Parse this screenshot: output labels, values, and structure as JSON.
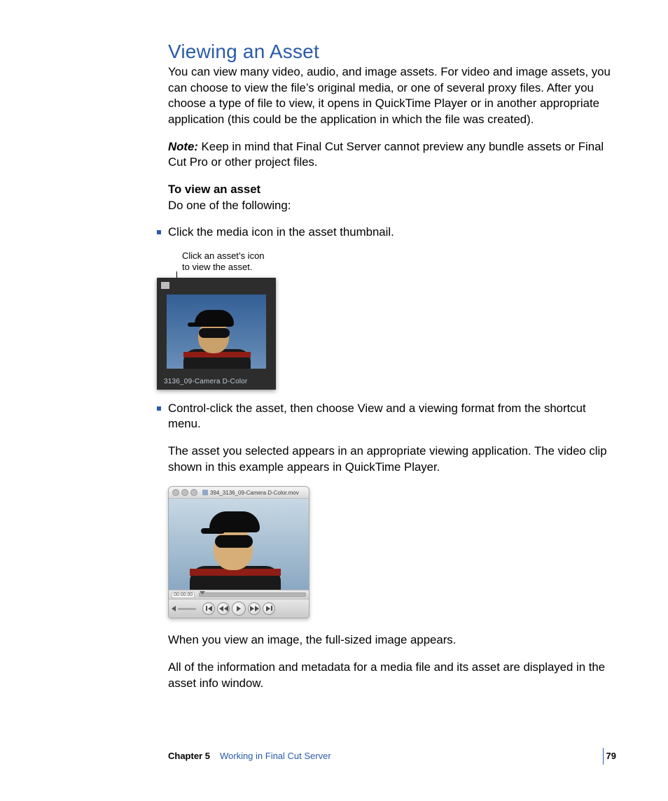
{
  "heading": "Viewing an Asset",
  "intro": "You can view many video, audio, and image assets. For video and image assets, you can choose to view the file’s original media, or one of several proxy files. After you choose a type of file to view, it opens in QuickTime Player or in another appropriate application (this could be the application in which the file was created).",
  "note_label": "Note:",
  "note_body": "  Keep in mind that Final Cut Server cannot preview any bundle assets or Final Cut Pro or other project files.",
  "task_heading": "To view an asset",
  "task_lead": "Do one of the following:",
  "bullet1": "Click the media icon in the asset thumbnail.",
  "callout_l1": "Click an asset’s icon",
  "callout_l2": "to view the asset.",
  "thumb_caption": "3136_09-Camera D-Color",
  "bullet2": "Control-click the asset, then choose View and a viewing format from the shortcut menu.",
  "after_bullet2": "The asset you selected appears in an appropriate viewing application. The video clip shown in this example appears in QuickTime Player.",
  "qt_title": "394_3136_09-Camera D-Color.mov",
  "qt_timecode": "00:00:00",
  "closing1": "When you view an image, the full-sized image appears.",
  "closing2": "All of the information and metadata for a media file and its asset are displayed in the asset info window.",
  "footer": {
    "chapter": "Chapter 5",
    "title": "Working in Final Cut Server",
    "page": "79"
  }
}
